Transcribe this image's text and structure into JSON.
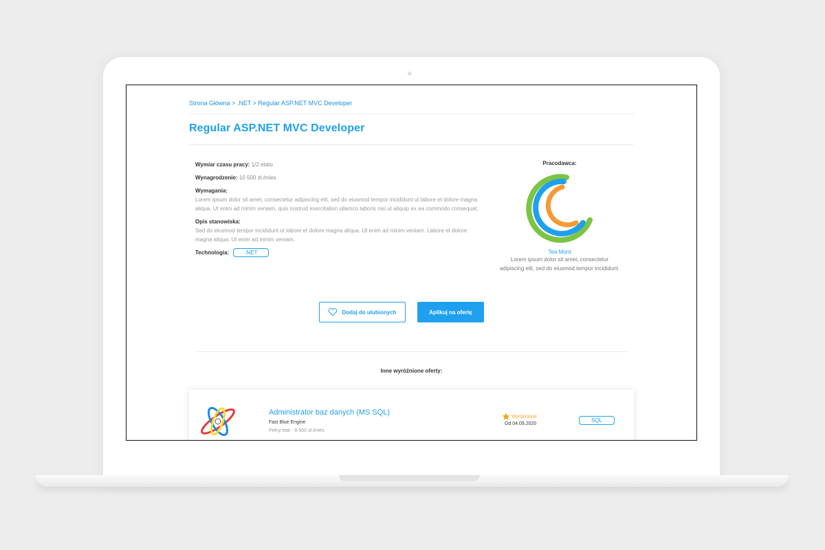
{
  "breadcrumb": {
    "home": "Strona Główna",
    "sep1": " > ",
    "category": ".NET",
    "sep2": " > ",
    "current": "Regular ASP.NET MVC Developer"
  },
  "job": {
    "title": "Regular ASP.NET MVC Developer",
    "worktime_label": "Wymiar czasu pracy:",
    "worktime_value": "1/2 etatu",
    "salary_label": "Wynagrodzenie:",
    "salary_value": "10 500 zł./mies.",
    "requirements_label": "Wymagania:",
    "requirements_text": "Lorem ipsum dolor sit amet, consectetur adipiscing elit, sed do eiusmod tempor incididunt ut labore et dolore magna aliqua. Ut enim ad minim veniam, quis nostrud exercitation ullamco laboris nisi ut aliquip ex ea commodo consequat.",
    "description_label": "Opis stanowiska:",
    "description_text": "Sed do eiusmod tempor incididunt ut labore et dolore magna aliqua. Ut enim ad minim veniam. Labore et dolore magna aliqua. Ut enim ad minim veniam.",
    "tech_label": "Technologia:",
    "tech_value": ".NET"
  },
  "employer": {
    "label": "Pracodawca:",
    "name": "Tea Mont",
    "description": "Lorem ipsum dolor sit amet, consectetur adipiscing elit, sed do eiusmod tempor incididunt.",
    "logo_colors": [
      "#1fa0ee",
      "#f39a33",
      "#7cc444"
    ]
  },
  "actions": {
    "favorite": "Dodaj do ulubionych",
    "apply": "Aplikuj na ofertę"
  },
  "other_offers": {
    "heading": "Inne wyróżnione oferty:",
    "items": [
      {
        "title": "Administrator baz danych (MS SQL)",
        "company": "Fast Blue Engine",
        "meta": "Pełny etat - 8 500 zł./mies.",
        "featured": "Wyróżnione",
        "date": "Od 04.09.2020",
        "tag": "SQL"
      }
    ]
  },
  "colors": {
    "accent": "#1fa0ee",
    "featured": "#f2a516"
  }
}
